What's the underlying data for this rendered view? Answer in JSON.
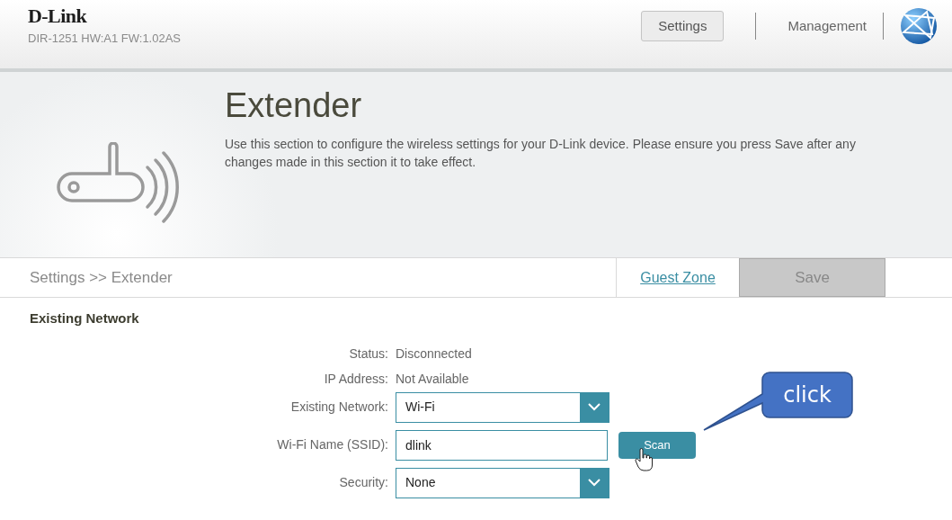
{
  "header": {
    "logo": "D-Link",
    "device_info": "DIR-1251 HW:A1 FW:1.02AS",
    "nav": [
      {
        "label": "Settings",
        "selected": true
      },
      {
        "label": "Management",
        "selected": false
      }
    ]
  },
  "hero": {
    "title": "Extender",
    "description": "Use this section to configure the wireless settings for your D-Link device. Please ensure you press Save after any changes made in this section it to take effect."
  },
  "toolbar": {
    "breadcrumb": "Settings >> Extender",
    "link": "Guest Zone",
    "save": "Save",
    "save_disabled": true
  },
  "section": {
    "title": "Existing Network",
    "fields": [
      {
        "kind": "text",
        "label": "Status:",
        "value": "Disconnected"
      },
      {
        "kind": "text",
        "label": "IP Address:",
        "value": "Not Available"
      },
      {
        "kind": "select",
        "label": "Existing Network:",
        "value": "Wi-Fi"
      },
      {
        "kind": "input",
        "label": "Wi-Fi Name (SSID):",
        "value": "dlink",
        "button": "Scan"
      },
      {
        "kind": "select",
        "label": "Security:",
        "value": "None"
      }
    ]
  },
  "annotation": {
    "text": "click"
  }
}
